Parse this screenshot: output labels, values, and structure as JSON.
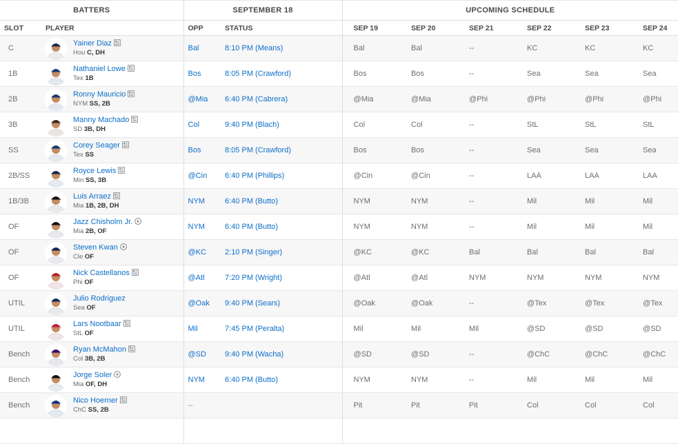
{
  "groups": {
    "batters": "BATTERS",
    "date": "SEPTEMBER 18",
    "upcoming": "UPCOMING SCHEDULE"
  },
  "columns": {
    "slot": "SLOT",
    "player": "PLAYER",
    "opp": "OPP",
    "status": "STATUS",
    "days": [
      "SEP 19",
      "SEP 20",
      "SEP 21",
      "SEP 22",
      "SEP 23",
      "SEP 24"
    ]
  },
  "rows": [
    {
      "slot": "C",
      "name": "Yainer Diaz",
      "team": "Hou",
      "pos": "C, DH",
      "icon": "news-icon",
      "jersey": "#ececec",
      "cap": "#1d2c4a",
      "opp": "Bal",
      "status": "8:10 PM (Means)",
      "schedule": [
        "Bal",
        "Bal",
        "--",
        "KC",
        "KC",
        "KC"
      ]
    },
    {
      "slot": "1B",
      "name": "Nathaniel Lowe",
      "team": "Tex",
      "pos": "1B",
      "icon": "news-icon",
      "jersey": "#e4e8ef",
      "cap": "#1b3a78",
      "opp": "Bos",
      "status": "8:05 PM (Crawford)",
      "schedule": [
        "Bos",
        "Bos",
        "--",
        "Sea",
        "Sea",
        "Sea"
      ]
    },
    {
      "slot": "2B",
      "name": "Ronny Mauricio",
      "team": "NYM",
      "pos": "SS, 2B",
      "icon": "news-icon",
      "jersey": "#e4e8ef",
      "cap": "#1b3a78",
      "opp": "@Mia",
      "status": "6:40 PM (Cabrera)",
      "schedule": [
        "@Mia",
        "@Mia",
        "@Phi",
        "@Phi",
        "@Phi",
        "@Phi"
      ]
    },
    {
      "slot": "3B",
      "name": "Manny Machado",
      "team": "SD",
      "pos": "3B, DH",
      "icon": "news-icon",
      "jersey": "#e9e6e0",
      "cap": "#3a2a1f",
      "opp": "Col",
      "status": "9:40 PM (Blach)",
      "schedule": [
        "Col",
        "Col",
        "--",
        "StL",
        "StL",
        "StL"
      ]
    },
    {
      "slot": "SS",
      "name": "Corey Seager",
      "team": "Tex",
      "pos": "SS",
      "icon": "news-icon",
      "jersey": "#e4e8ef",
      "cap": "#1b3a78",
      "opp": "Bos",
      "status": "8:05 PM (Crawford)",
      "schedule": [
        "Bos",
        "Bos",
        "--",
        "Sea",
        "Sea",
        "Sea"
      ]
    },
    {
      "slot": "2B/SS",
      "name": "Royce Lewis",
      "team": "Min",
      "pos": "SS, 3B",
      "icon": "news-icon",
      "jersey": "#e4e8ef",
      "cap": "#13284f",
      "opp": "@Cin",
      "status": "6:40 PM (Phillips)",
      "schedule": [
        "@Cin",
        "@Cin",
        "--",
        "LAA",
        "LAA",
        "LAA"
      ]
    },
    {
      "slot": "1B/3B",
      "name": "Luis Arraez",
      "team": "Mia",
      "pos": "1B, 2B, DH",
      "icon": "news-icon",
      "jersey": "#e8eaec",
      "cap": "#111111",
      "opp": "NYM",
      "status": "6:40 PM (Butto)",
      "schedule": [
        "NYM",
        "NYM",
        "--",
        "Mil",
        "Mil",
        "Mil"
      ]
    },
    {
      "slot": "OF",
      "name": "Jazz Chisholm Jr.",
      "team": "Mia",
      "pos": "2B, OF",
      "icon": "video-icon",
      "jersey": "#e8eaec",
      "cap": "#111111",
      "opp": "NYM",
      "status": "6:40 PM (Butto)",
      "schedule": [
        "NYM",
        "NYM",
        "--",
        "Mil",
        "Mil",
        "Mil"
      ]
    },
    {
      "slot": "OF",
      "name": "Steven Kwan",
      "team": "Cle",
      "pos": "OF",
      "icon": "video-icon",
      "jersey": "#e8eaec",
      "cap": "#13284f",
      "opp": "@KC",
      "status": "2:10 PM (Singer)",
      "schedule": [
        "@KC",
        "@KC",
        "Bal",
        "Bal",
        "Bal",
        "Bal"
      ]
    },
    {
      "slot": "OF",
      "name": "Nick Castellanos",
      "team": "Phi",
      "pos": "OF",
      "icon": "news-icon",
      "jersey": "#f1e4e4",
      "cap": "#b8202d",
      "opp": "@Atl",
      "status": "7:20 PM (Wright)",
      "schedule": [
        "@Atl",
        "@Atl",
        "NYM",
        "NYM",
        "NYM",
        "NYM"
      ]
    },
    {
      "slot": "UTIL",
      "name": "Julio Rodriguez",
      "team": "Sea",
      "pos": "OF",
      "icon": "",
      "jersey": "#e8eaec",
      "cap": "#0c2c56",
      "opp": "@Oak",
      "status": "9:40 PM (Sears)",
      "schedule": [
        "@Oak",
        "@Oak",
        "--",
        "@Tex",
        "@Tex",
        "@Tex"
      ]
    },
    {
      "slot": "UTIL",
      "name": "Lars Nootbaar",
      "team": "StL",
      "pos": "OF",
      "icon": "news-icon",
      "jersey": "#f1e4e4",
      "cap": "#c41e3a",
      "opp": "Mil",
      "status": "7:45 PM (Peralta)",
      "schedule": [
        "Mil",
        "Mil",
        "Mil",
        "@SD",
        "@SD",
        "@SD"
      ]
    },
    {
      "slot": "Bench",
      "name": "Ryan McMahon",
      "team": "Col",
      "pos": "3B, 2B",
      "icon": "news-icon",
      "jersey": "#e8e6ec",
      "cap": "#33006f",
      "opp": "@SD",
      "status": "9:40 PM (Wacha)",
      "schedule": [
        "@SD",
        "@SD",
        "--",
        "@ChC",
        "@ChC",
        "@ChC"
      ]
    },
    {
      "slot": "Bench",
      "name": "Jorge Soler",
      "team": "Mia",
      "pos": "OF, DH",
      "icon": "video-icon",
      "jersey": "#e8eaec",
      "cap": "#111111",
      "opp": "NYM",
      "status": "6:40 PM (Butto)",
      "schedule": [
        "NYM",
        "NYM",
        "--",
        "Mil",
        "Mil",
        "Mil"
      ]
    },
    {
      "slot": "Bench",
      "name": "Nico Hoerner",
      "team": "ChC",
      "pos": "SS, 2B",
      "icon": "news-icon",
      "jersey": "#e4e8ef",
      "cap": "#0e3386",
      "opp": "--",
      "status": "",
      "schedule": [
        "Pit",
        "Pit",
        "Pit",
        "Col",
        "Col",
        "Col"
      ]
    },
    {
      "slot": "",
      "name": "",
      "team": "",
      "pos": "",
      "icon": "",
      "jersey": "#ffffff",
      "cap": "#ffffff",
      "opp": "",
      "status": "",
      "schedule": [
        "",
        "",
        "",
        "",
        "",
        ""
      ]
    }
  ],
  "colors": {
    "link": "#0d6ec8",
    "muted": "#6c6d6f",
    "stripe": "#f7f7f8",
    "border": "#dcdddf"
  }
}
